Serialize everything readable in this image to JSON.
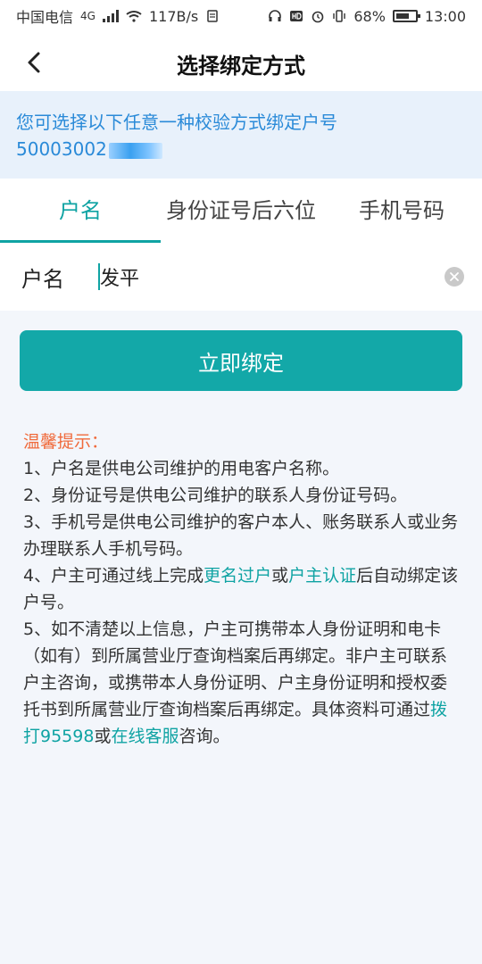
{
  "status_bar": {
    "carrier": "中国电信",
    "signal_tag": "4G",
    "speed": "117B/s",
    "battery": "68%",
    "time": "13:00"
  },
  "nav": {
    "title": "选择绑定方式"
  },
  "notice": {
    "line1": "您可选择以下任意一种校验方式绑定户号",
    "account_prefix": "50003002"
  },
  "tabs": [
    {
      "label": "户名"
    },
    {
      "label": "身份证号后六位"
    },
    {
      "label": "手机号码"
    }
  ],
  "field": {
    "label": "户名",
    "value": "发平"
  },
  "bind_button": {
    "label": "立即绑定"
  },
  "tips": {
    "title": "温馨提示：",
    "item1": "1、户名是供电公司维护的用电客户名称。",
    "item2": "2、身份证号是供电公司维护的联系人身份证号码。",
    "item3": "3、手机号是供电公司维护的客户本人、账务联系人或业务办理联系人手机号码。",
    "item4_a": "4、户主可通过线上完成",
    "item4_link1": "更名过户",
    "item4_b": "或",
    "item4_link2": "户主认证",
    "item4_c": "后自动绑定该户号。",
    "item5_a": "5、如不清楚以上信息，户主可携带本人身份证明和电卡（如有）到所属营业厅查询档案后再绑定。非户主可联系户主咨询，或携带本人身份证明、户主身份证明和授权委托书到所属营业厅查询档案后再绑定。具体资料可通过",
    "item5_link1": "拨打95598",
    "item5_b": "或",
    "item5_link2": "在线客服",
    "item5_c": "咨询。"
  },
  "colors": {
    "accent": "#13a8a8",
    "notice_text": "#2a8ad8",
    "tips_title": "#f06a3b"
  }
}
